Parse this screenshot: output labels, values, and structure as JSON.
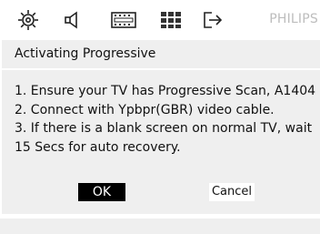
{
  "menubar": {
    "icons": [
      "gear-icon",
      "speaker-icon",
      "film-icon",
      "grid-icon",
      "exit-icon"
    ],
    "brand": "PHILIPS"
  },
  "dialog": {
    "title": "Activating Progressive",
    "lines": [
      "1. Ensure your TV has Progressive Scan, A1404",
      "2. Connect with Ypbpr(GBR) video cable.",
      "3. If there is a blank screen on normal TV, wait",
      "15 Secs for auto recovery."
    ],
    "ok_label": "OK",
    "cancel_label": "Cancel"
  },
  "colors": {
    "panel_bg": "#efefef",
    "selected_button_bg": "#000000",
    "brand_text": "#bdbdbd"
  }
}
